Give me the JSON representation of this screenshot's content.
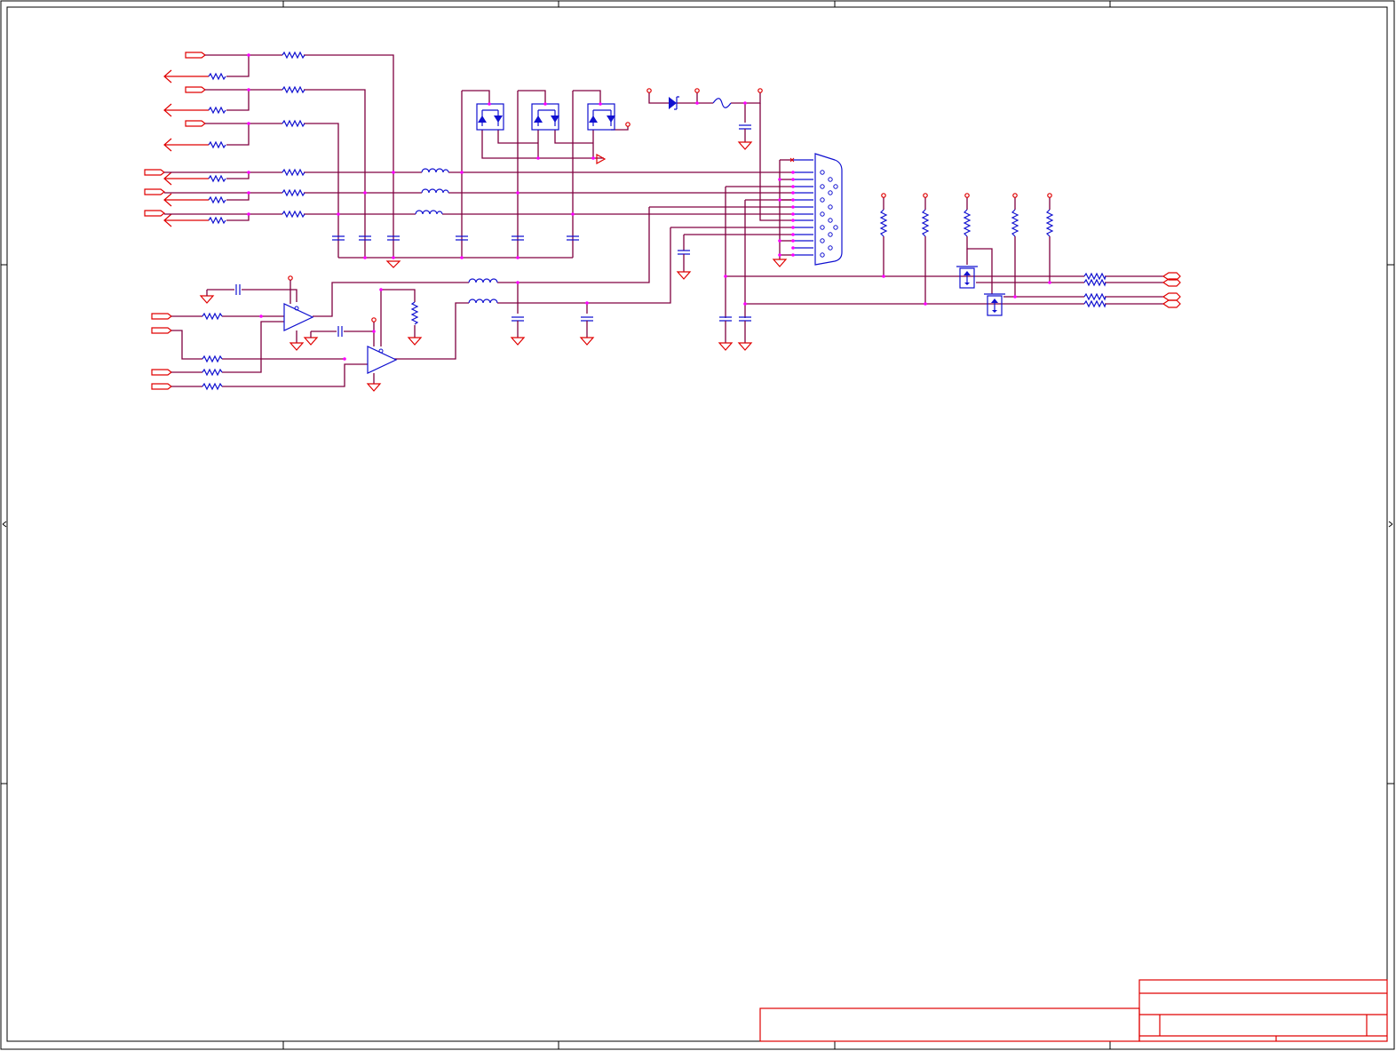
{
  "sheet": {
    "frame_color": "#000000",
    "wire_color": "#800040",
    "port_color": "#e00000",
    "symbol_color": "#1010d0",
    "junction_color": "#ff00ff"
  },
  "title_block": {
    "title": "",
    "size": "",
    "number": "",
    "revision": "",
    "date": "",
    "sheet": ""
  },
  "components": {
    "connector": "db15-connector-icon",
    "diode_arrays": 3,
    "op_amps": 2,
    "mosfets": 2
  }
}
